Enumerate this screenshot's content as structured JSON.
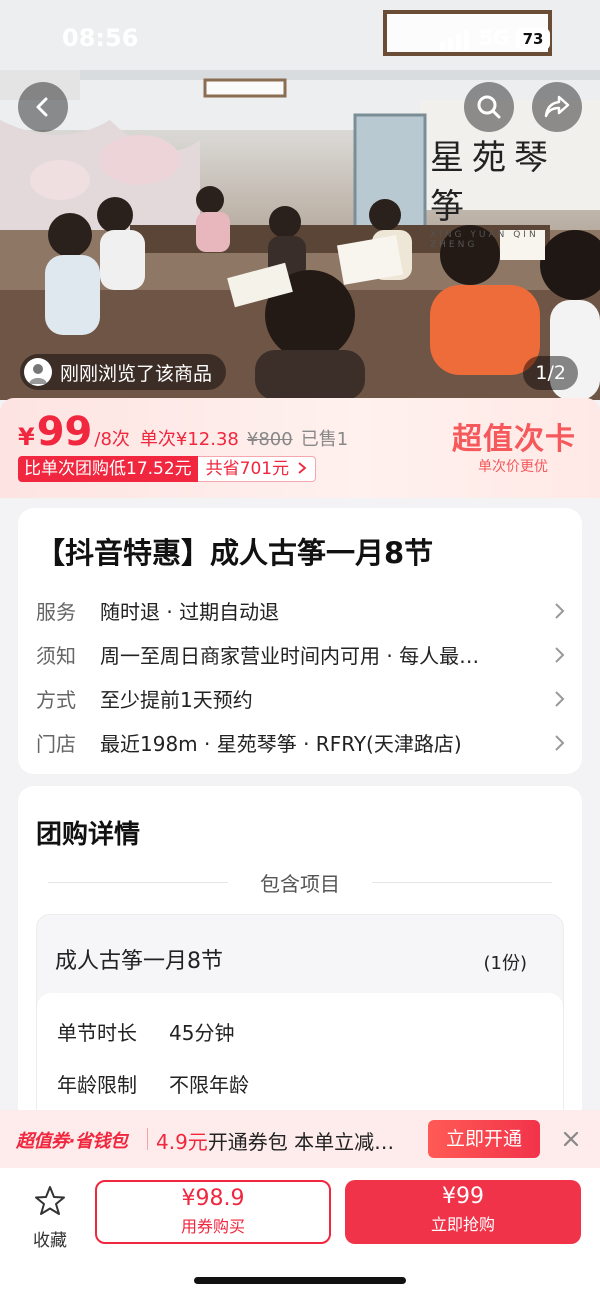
{
  "status_bar": {
    "time": "08:56",
    "network": "5G",
    "battery": "73"
  },
  "hero": {
    "browsed_text": "刚刚浏览了该商品",
    "counter": "1/2",
    "sign_text": "星苑琴筝",
    "sign_sub": "XING YUAN QIN ZHENG"
  },
  "price": {
    "currency": "¥",
    "value": "99",
    "unit": "/8次",
    "single": "单次¥12.38",
    "original": "¥800",
    "sold": "已售1",
    "tag_lower": "比单次团购低17.52元",
    "tag_save": "共省701元",
    "promo_title": "超值次卡",
    "promo_sub": "单次价更优"
  },
  "info": {
    "title": "【抖音特惠】成人古筝一月8节",
    "rows": [
      {
        "label": "服务",
        "value": "随时退 · 过期自动退"
      },
      {
        "label": "须知",
        "value": "周一至周日商家营业时间内可用 · 每人最…"
      },
      {
        "label": "方式",
        "value": "至少提前1天预约"
      },
      {
        "label": "门店",
        "value": "最近198m · 星苑琴筝 · RFRY(天津路店)"
      }
    ]
  },
  "detail": {
    "title": "团购详情",
    "divider": "包含项目",
    "item_name": "成人古筝一月8节",
    "item_qty": "(1份)",
    "specs": [
      {
        "key": "单节时长",
        "value": "45分钟"
      },
      {
        "key": "年龄限制",
        "value": "不限年龄"
      }
    ]
  },
  "coupon_bar": {
    "brand": "超值券·省钱包",
    "price_highlight": "4.9元",
    "text": "开通券包 本单立减…",
    "button": "立即开通"
  },
  "bottom": {
    "fav_label": "收藏",
    "coupon_price": "¥98.9",
    "coupon_label": "用券购买",
    "buy_price": "¥99",
    "buy_label": "立即抢购"
  },
  "colors": {
    "accent": "#f0273e",
    "promo": "#f5595c",
    "band": "#fde4e2"
  }
}
